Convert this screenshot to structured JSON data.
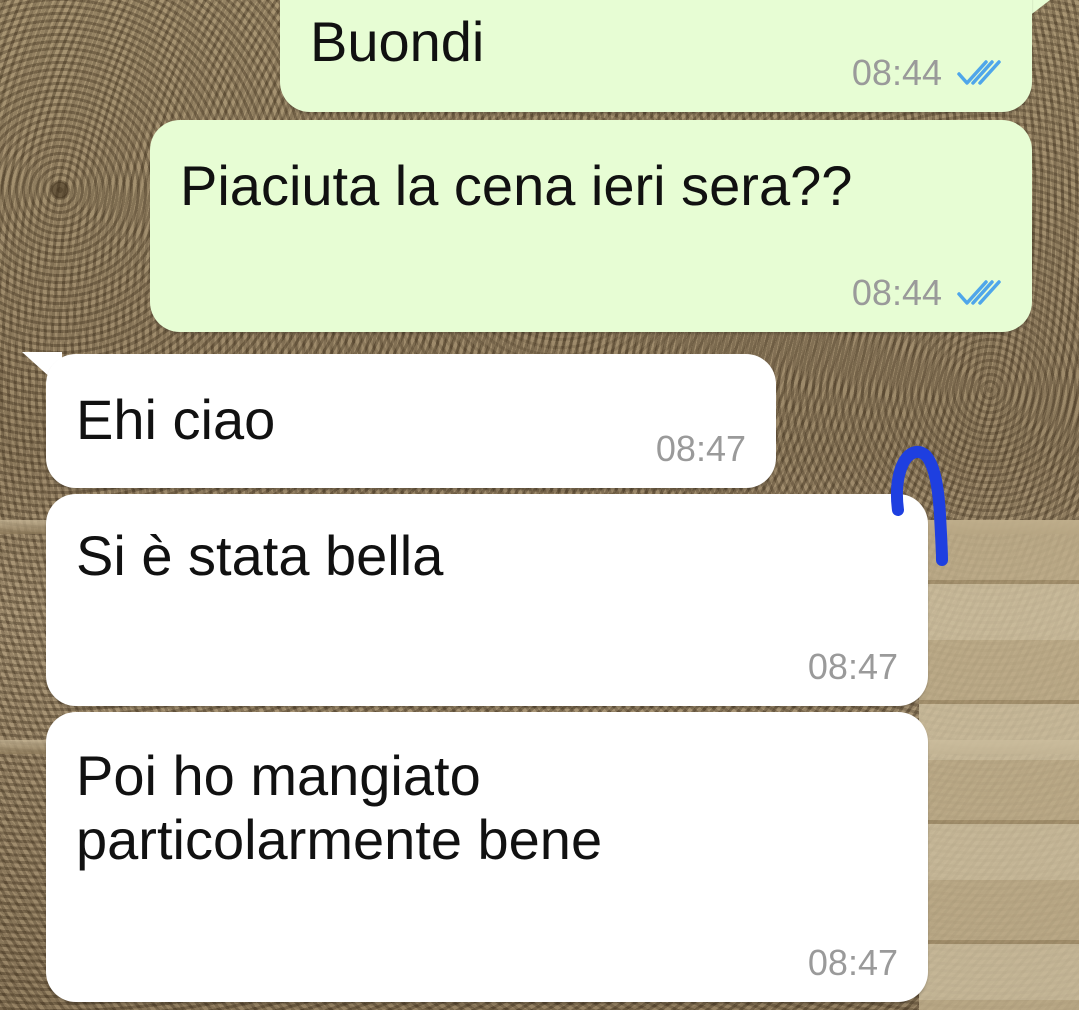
{
  "chat": {
    "messages": [
      {
        "direction": "outgoing",
        "text": "Buondi",
        "time": "08:44",
        "status": "read-double-check-icon"
      },
      {
        "direction": "outgoing",
        "text": "Piaciuta la cena ieri sera??",
        "time": "08:44",
        "status": "read-double-check-icon"
      },
      {
        "direction": "incoming",
        "text": "Ehi ciao",
        "time": "08:47"
      },
      {
        "direction": "incoming",
        "text": "Si è stata bella",
        "time": "08:47"
      },
      {
        "direction": "incoming",
        "text": "Poi ho mangiato\nparticolarmente bene",
        "time": "08:47"
      }
    ]
  },
  "colors": {
    "outgoing_bubble": "#e7fdd4",
    "incoming_bubble": "#ffffff",
    "read_tick": "#4fa6ea",
    "annotation_stroke": "#1e3fe0"
  }
}
